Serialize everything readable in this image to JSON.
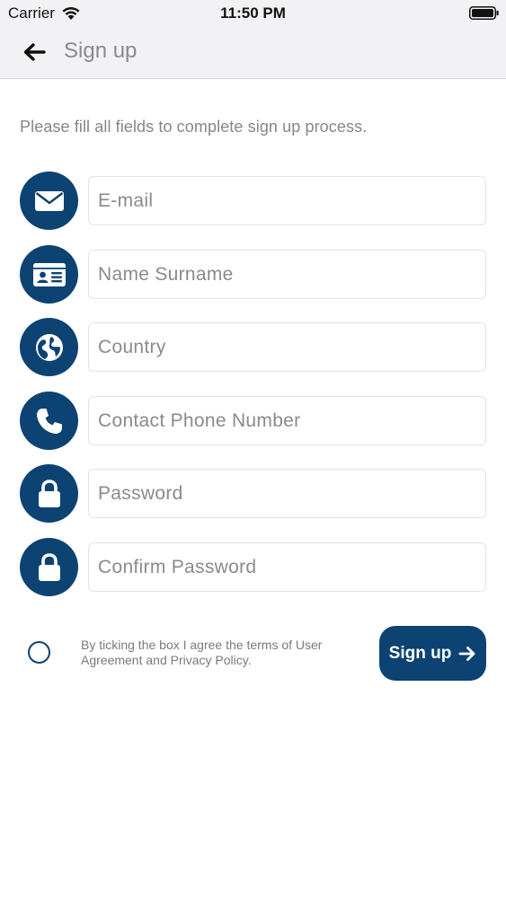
{
  "status_bar": {
    "carrier": "Carrier",
    "time": "11:50 PM"
  },
  "nav": {
    "title": "Sign up",
    "back_icon": "arrow-left-icon"
  },
  "instruction": "Please fill all fields to complete sign up process.",
  "fields": [
    {
      "icon": "envelope-icon",
      "placeholder": "E-mail",
      "value": ""
    },
    {
      "icon": "id-card-icon",
      "placeholder": "Name Surname",
      "value": ""
    },
    {
      "icon": "globe-icon",
      "placeholder": "Country",
      "value": ""
    },
    {
      "icon": "phone-icon",
      "placeholder": "Contact Phone Number",
      "value": ""
    },
    {
      "icon": "lock-icon",
      "placeholder": "Password",
      "value": ""
    },
    {
      "icon": "lock-icon",
      "placeholder": "Confirm Password",
      "value": ""
    }
  ],
  "agreement": {
    "checked": false,
    "text": "By ticking the box I agree the terms of User Agreement and Privacy Policy."
  },
  "signup_button": {
    "label": "Sign up",
    "icon": "arrow-right-icon"
  },
  "colors": {
    "accent": "#0d4373",
    "nav_background": "#f2f2f4",
    "placeholder": "#8a8a8e"
  }
}
